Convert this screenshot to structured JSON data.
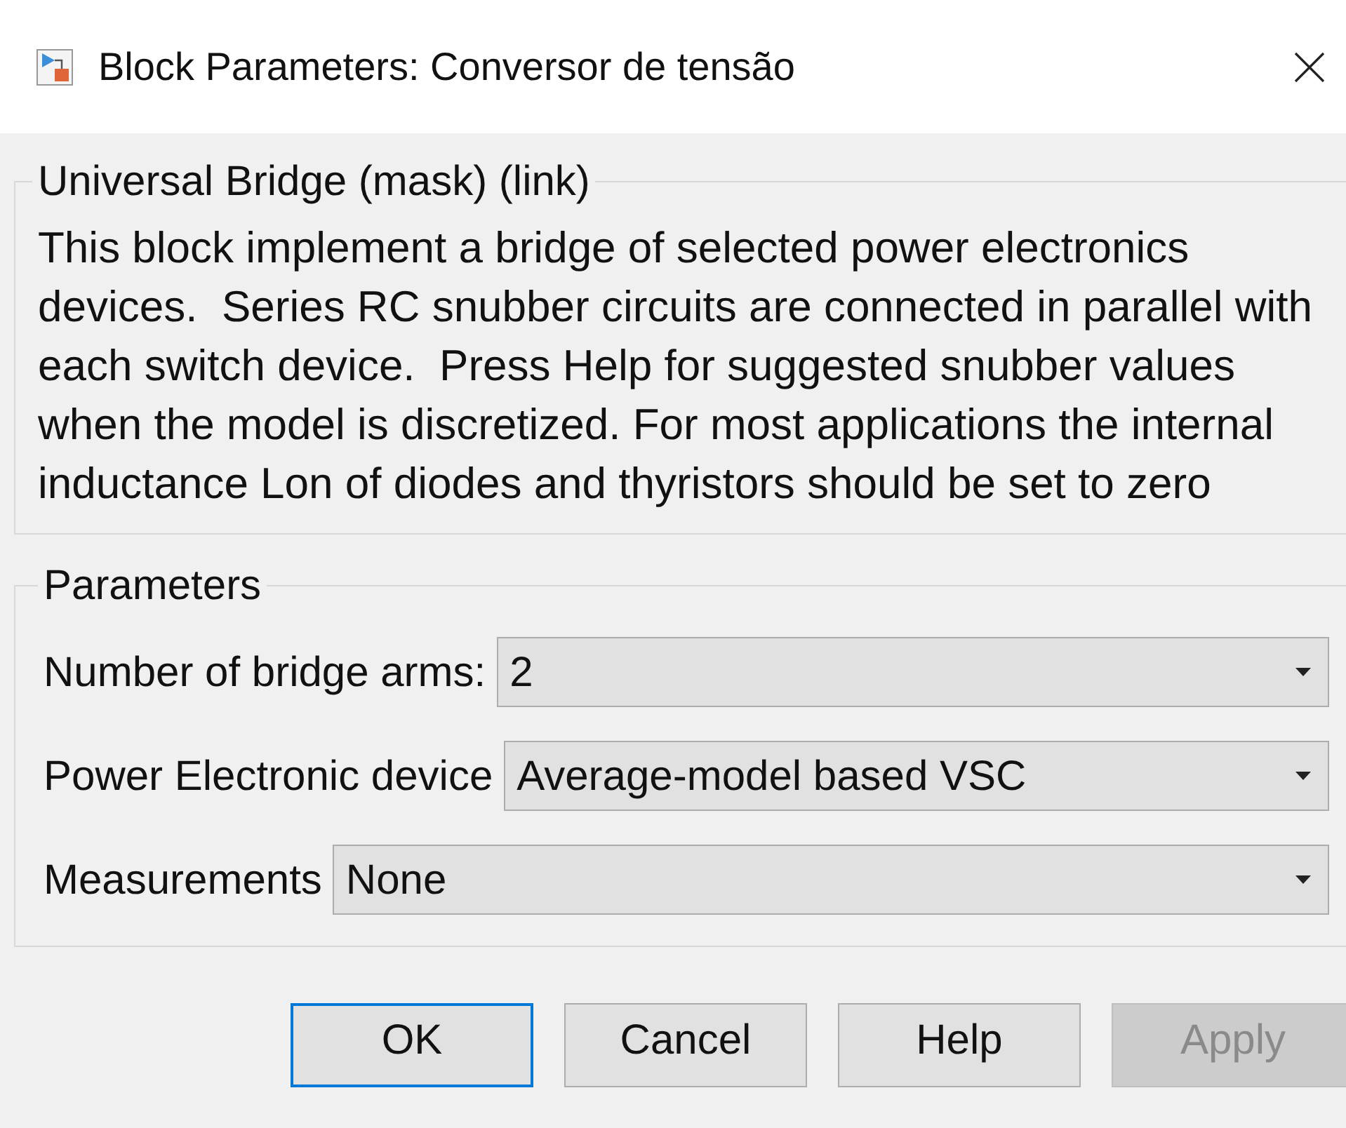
{
  "window": {
    "title": "Block Parameters: Conversor de tensão"
  },
  "description_group": {
    "title": "Universal Bridge (mask) (link)",
    "text": "This block implement a bridge of selected power electronics devices.  Series RC snubber circuits are connected in parallel with each switch device.  Press Help for suggested snubber values when the model is discretized. For most applications the internal inductance Lon of diodes and thyristors should be set to zero"
  },
  "parameters_group": {
    "title": "Parameters",
    "fields": [
      {
        "label": "Number of bridge arms:",
        "value": "2"
      },
      {
        "label": "Power Electronic device",
        "value": "Average-model based VSC"
      },
      {
        "label": "Measurements",
        "value": "None"
      }
    ]
  },
  "buttons": [
    {
      "label": "OK",
      "default": true,
      "disabled": false
    },
    {
      "label": "Cancel",
      "default": false,
      "disabled": false
    },
    {
      "label": "Help",
      "default": false,
      "disabled": false
    },
    {
      "label": "Apply",
      "default": false,
      "disabled": true
    }
  ]
}
